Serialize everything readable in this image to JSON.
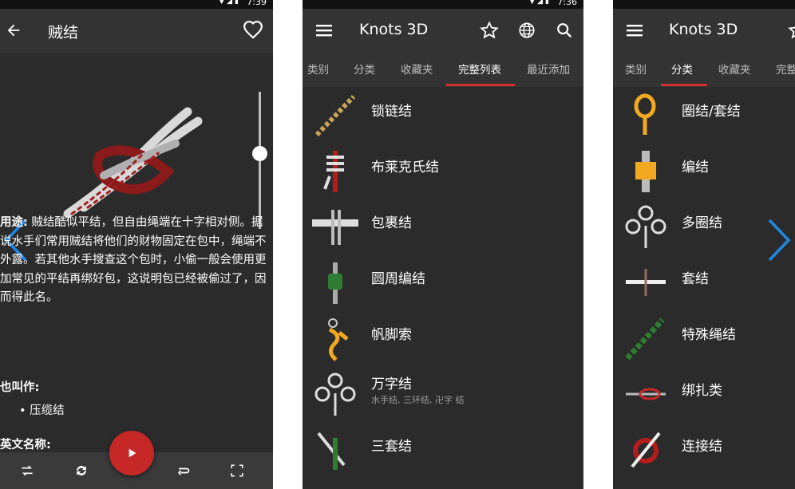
{
  "status": {
    "time_left": "7:39",
    "time_mid": "7:36"
  },
  "detail": {
    "title": "贼结",
    "usage_label": "用途:",
    "usage_text": " 贼结酷似平结，但自由绳端在十字相对侧。据说水手们常用贼结将他们的财物固定在包中，绳端不外露。若其他水手搜查这个包时，小偷一般会使用更加常见的平结再绑好包，这说明包已经被偷过了，因而得此名。",
    "aka_label": "也叫作:",
    "aka_items": [
      "• 压缆结"
    ],
    "english_label": "英文名称:",
    "slider_value": 0.45
  },
  "list_screen": {
    "title": "Knots 3D",
    "tabs": [
      "类别",
      "分类",
      "收藏夹",
      "完整列表",
      "最近添加"
    ],
    "active_tab": "完整列表",
    "items": [
      {
        "label": "锁链结",
        "sub": ""
      },
      {
        "label": "布莱克氏结",
        "sub": ""
      },
      {
        "label": "包裹结",
        "sub": ""
      },
      {
        "label": "圆周编结",
        "sub": ""
      },
      {
        "label": "帆脚索",
        "sub": ""
      },
      {
        "label": "万字结",
        "sub": "水手结, 三环结, 卍字 结"
      },
      {
        "label": "三套结",
        "sub": ""
      }
    ]
  },
  "category_screen": {
    "title": "Knots 3D",
    "tabs": [
      "类别",
      "分类",
      "收藏夹",
      "完整"
    ],
    "active_tab": "分类",
    "items": [
      {
        "label": "圈结/套结"
      },
      {
        "label": "编结"
      },
      {
        "label": "多圈结"
      },
      {
        "label": "套结"
      },
      {
        "label": "特殊绳结"
      },
      {
        "label": "绑扎类"
      },
      {
        "label": "连接结"
      }
    ]
  },
  "colors": {
    "accent": "#d32f2f",
    "nav_arrow": "#1e88e5",
    "background": "#2b2b2b",
    "appbar": "#333333"
  }
}
